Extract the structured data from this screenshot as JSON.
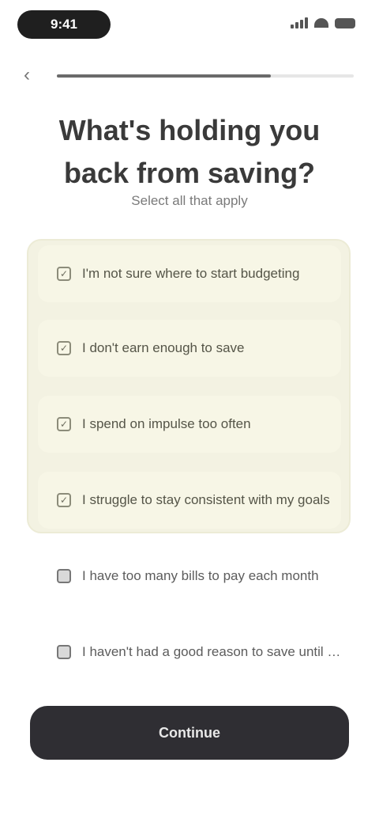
{
  "status_bar": {
    "time": "9:41"
  },
  "nav": {
    "back_icon": "chevron-left-icon",
    "progress_fraction": 0.72
  },
  "header": {
    "title": "What's holding you back from saving?",
    "subtitle": "Select all that apply"
  },
  "options": [
    {
      "label": "I'm not sure where to start budgeting",
      "selected": true
    },
    {
      "label": "I don't earn enough to save",
      "selected": true
    },
    {
      "label": "I spend on impulse too often",
      "selected": true
    },
    {
      "label": "I struggle to stay consistent with my goals",
      "selected": true
    },
    {
      "label": "I have too many bills to pay each month",
      "selected": false
    },
    {
      "label": "I haven't had a good reason to save until now",
      "selected": false
    }
  ],
  "footer": {
    "continue_label": "Continue"
  },
  "colors": {
    "selected_bg": "#f3f2e2",
    "button_bg": "#2f2e33"
  }
}
